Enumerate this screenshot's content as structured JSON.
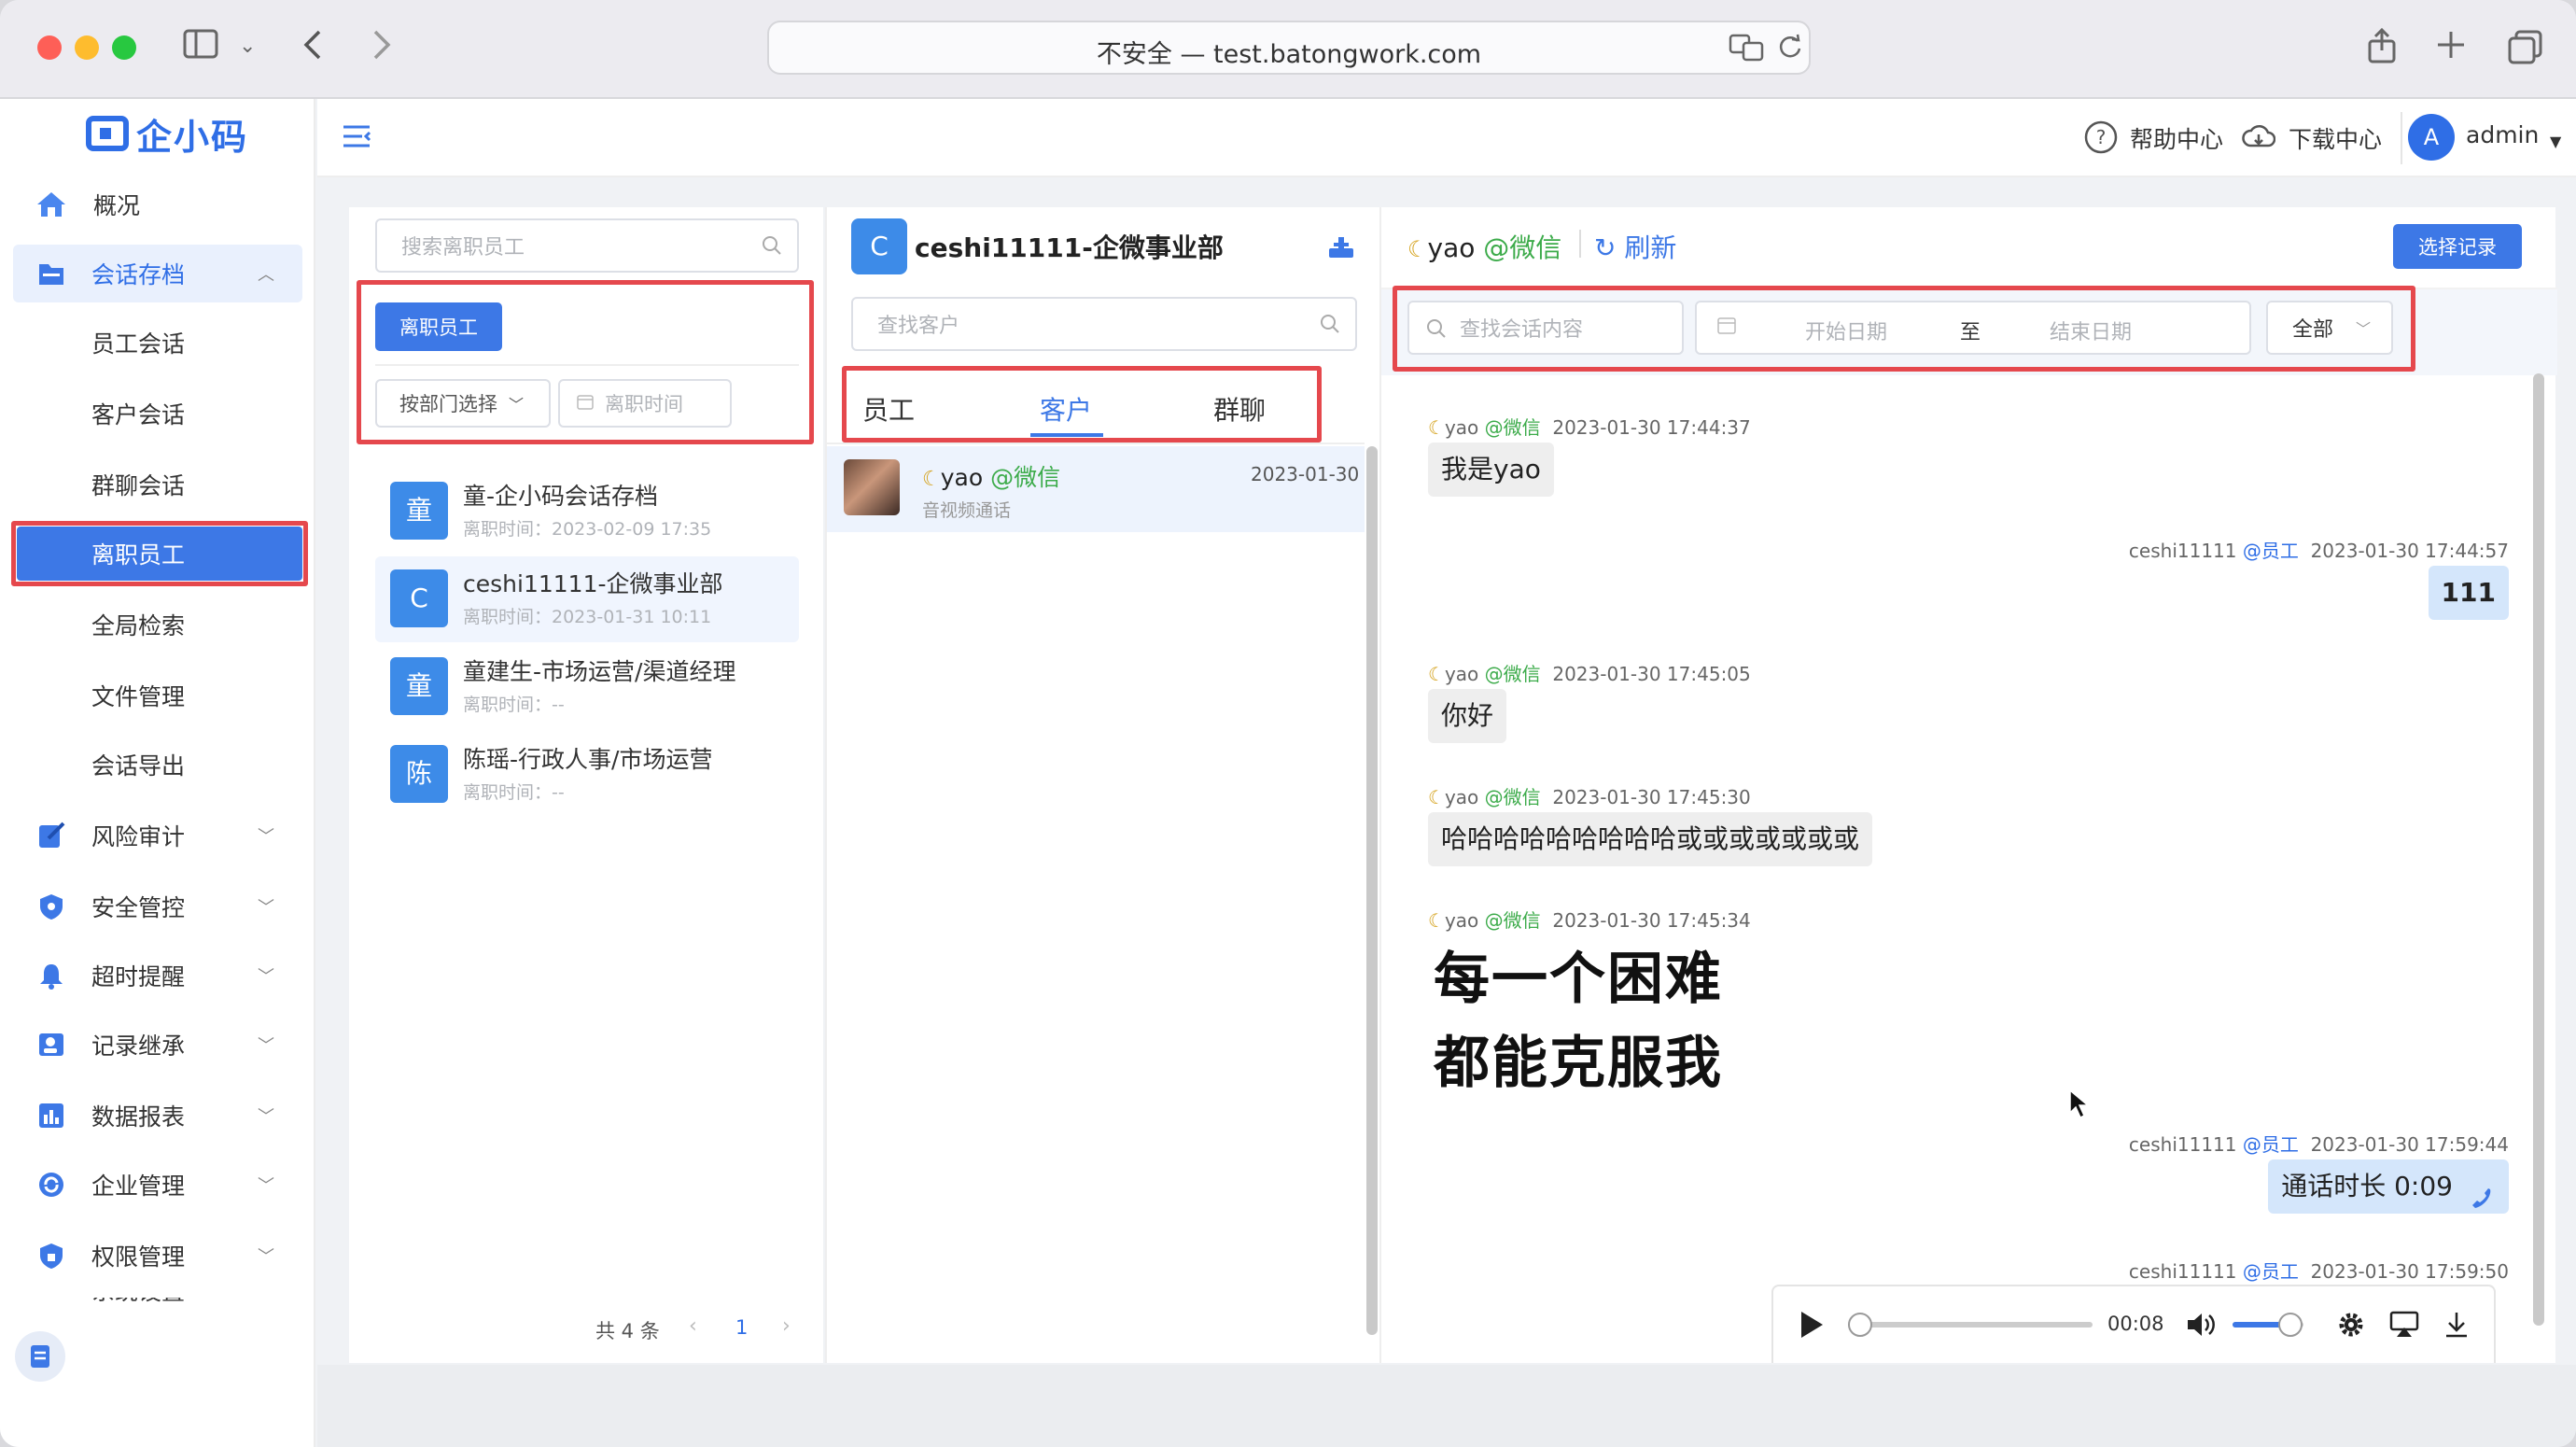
{
  "browser": {
    "url": "不安全 — test.batongwork.com"
  },
  "brand": {
    "name": "企小码",
    "accent": "#2f6ee6",
    "alert": "#e5484d"
  },
  "sidebar": {
    "items": [
      {
        "label": "概况",
        "icon": "home-icon"
      },
      {
        "label": "会话存档",
        "icon": "folder-icon"
      },
      {
        "label": "员工会话"
      },
      {
        "label": "客户会话"
      },
      {
        "label": "群聊会话"
      },
      {
        "label": "离职员工"
      },
      {
        "label": "全局检索"
      },
      {
        "label": "文件管理"
      },
      {
        "label": "会话导出"
      },
      {
        "label": "风险审计",
        "icon": "edit-icon"
      },
      {
        "label": "安全管控",
        "icon": "shield-icon"
      },
      {
        "label": "超时提醒",
        "icon": "bell-icon"
      },
      {
        "label": "记录继承",
        "icon": "user-card-icon"
      },
      {
        "label": "数据报表",
        "icon": "bar-chart-icon"
      },
      {
        "label": "企业管理",
        "icon": "refresh-icon"
      },
      {
        "label": "权限管理",
        "icon": "lock-shield-icon"
      },
      {
        "label": "系统设置"
      }
    ]
  },
  "header": {
    "help": "帮助中心",
    "download": "下载中心",
    "user_initial": "A",
    "user_name": "admin"
  },
  "left_panel": {
    "search_placeholder": "搜索离职员工",
    "tab_button": "离职员工",
    "dept_select": "按部门选择",
    "date_placeholder": "离职时间",
    "employees": [
      {
        "initial": "童",
        "name": "童-企小码会话存档",
        "sub": "离职时间：2023-02-09 17:35"
      },
      {
        "initial": "C",
        "name": "ceshi11111-企微事业部",
        "sub": "离职时间：2023-01-31 10:11"
      },
      {
        "initial": "童",
        "name": "童建生-市场运营/渠道经理",
        "sub": "离职时间：--"
      },
      {
        "initial": "陈",
        "name": "陈瑶-行政人事/市场运营",
        "sub": "离职时间：--"
      }
    ],
    "pagination": {
      "total": "共 4 条",
      "page": "1"
    }
  },
  "middle_panel": {
    "avatar_initial": "C",
    "title": "ceshi11111-企微事业部",
    "search_placeholder": "查找客户",
    "tabs": [
      "员工",
      "客户",
      "群聊"
    ],
    "contact": {
      "name": "yao",
      "tag": "@微信",
      "date": "2023-01-30",
      "last": "音视频通话"
    }
  },
  "right_panel": {
    "title_name": "yao",
    "title_tag": "@微信",
    "refresh": "刷新",
    "select_btn": "选择记录",
    "search_placeholder": "查找会话内容",
    "start_date": "开始日期",
    "to": "至",
    "end_date": "结束日期",
    "type_select": "全部",
    "messages": [
      {
        "side": "left",
        "name": "yao",
        "tag": "@微信",
        "time": "2023-01-30 17:44:37",
        "text": "我是yao"
      },
      {
        "side": "right",
        "name": "ceshi11111",
        "tag": "@员工",
        "time": "2023-01-30 17:44:57",
        "text": "111"
      },
      {
        "side": "left",
        "name": "yao",
        "tag": "@微信",
        "time": "2023-01-30 17:45:05",
        "text": "你好"
      },
      {
        "side": "left",
        "name": "yao",
        "tag": "@微信",
        "time": "2023-01-30 17:45:30",
        "text": "哈哈哈哈哈哈哈哈哈或或或或或或或"
      },
      {
        "side": "left",
        "name": "yao",
        "tag": "@微信",
        "time": "2023-01-30 17:45:34",
        "text": "每一个困难\n都能克服我"
      },
      {
        "side": "right",
        "name": "ceshi11111",
        "tag": "@员工",
        "time": "2023-01-30 17:59:44",
        "text": "通话时长 0:09"
      },
      {
        "side": "right",
        "name": "ceshi11111",
        "tag": "@员工",
        "time": "2023-01-30 17:59:50",
        "text": ""
      }
    ],
    "audio": {
      "time": "00:08",
      "progress": 0.0,
      "volume": 0.8
    }
  }
}
